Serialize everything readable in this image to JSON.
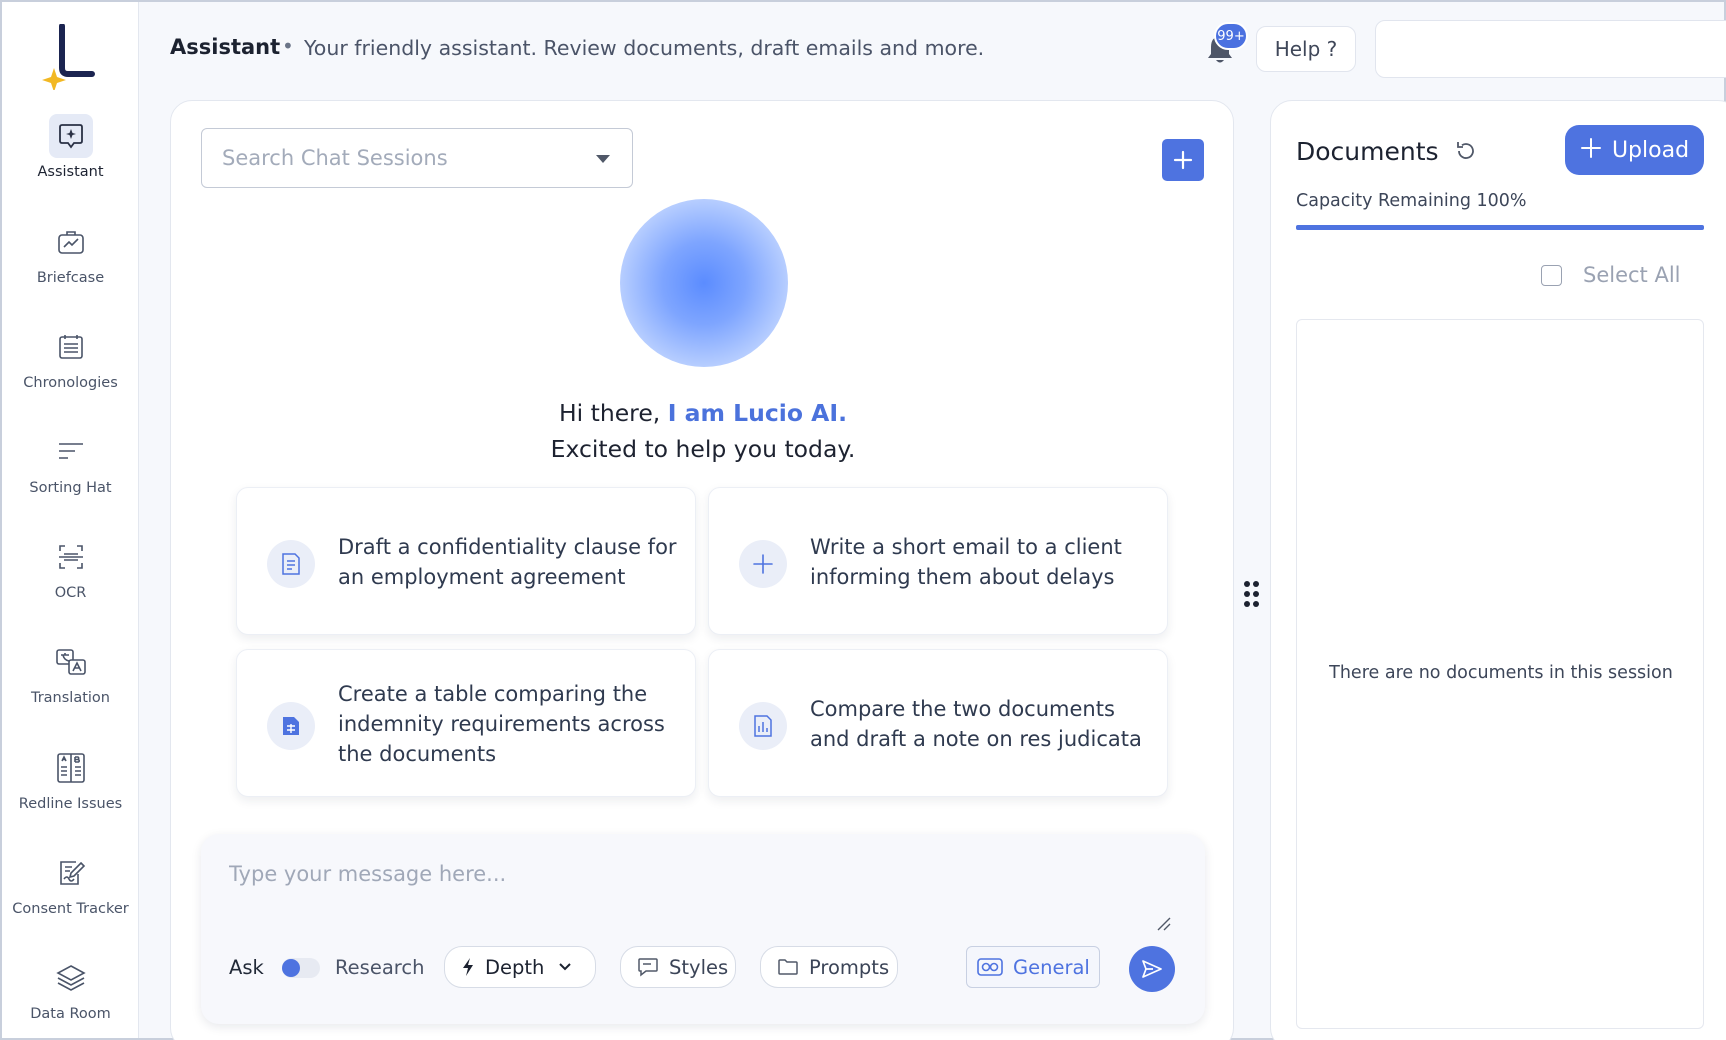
{
  "sidebar": {
    "items": [
      {
        "label": "Assistant",
        "icon": "assistant-sparkle-icon",
        "active": true
      },
      {
        "label": "Briefcase",
        "icon": "briefcase-icon"
      },
      {
        "label": "Chronologies",
        "icon": "list-calendar-icon"
      },
      {
        "label": "Sorting Hat",
        "icon": "sort-lines-icon"
      },
      {
        "label": "OCR",
        "icon": "scan-document-icon"
      },
      {
        "label": "Translation",
        "icon": "translate-icon"
      },
      {
        "label": "Redline Issues",
        "icon": "compare-columns-icon"
      },
      {
        "label": "Consent Tracker",
        "icon": "edit-document-icon"
      },
      {
        "label": "Data Room",
        "icon": "stack-layers-icon"
      }
    ]
  },
  "header": {
    "title": "Assistant",
    "separator": "•",
    "subtitle": "Your friendly assistant. Review documents, draft emails and more.",
    "notification_badge": "99+",
    "help_label": "Help ?"
  },
  "chat": {
    "search_placeholder": "Search Chat Sessions",
    "greeting_prefix": "Hi there, ",
    "greeting_name": "I am Lucio AI.",
    "greeting_line2": "Excited to help you today.",
    "suggestions": [
      {
        "text": "Draft a confidentiality clause for an employment agreement",
        "icon": "document-lines-icon"
      },
      {
        "text": "Write a short email to a client informing them about delays",
        "icon": "plus-icon"
      },
      {
        "text": "Create a table comparing the indemnity requirements across the documents",
        "icon": "file-table-icon"
      },
      {
        "text": "Compare the two documents and draft a note on res judicata",
        "icon": "file-chart-icon"
      }
    ],
    "composer": {
      "placeholder": "Type your message here...",
      "mode_ask": "Ask",
      "mode_research": "Research",
      "depth_label": "Depth",
      "styles_label": "Styles",
      "prompts_label": "Prompts",
      "general_label": "General"
    }
  },
  "documents": {
    "title": "Documents",
    "upload_label": "Upload",
    "capacity_label": "Capacity Remaining 100%",
    "capacity_fraction": 1.0,
    "select_all_label": "Select All",
    "empty_message": "There are no documents in this session"
  },
  "colors": {
    "accent": "#4e73e0",
    "logo_star": "#f2b824",
    "logo_l": "#1b2450"
  }
}
